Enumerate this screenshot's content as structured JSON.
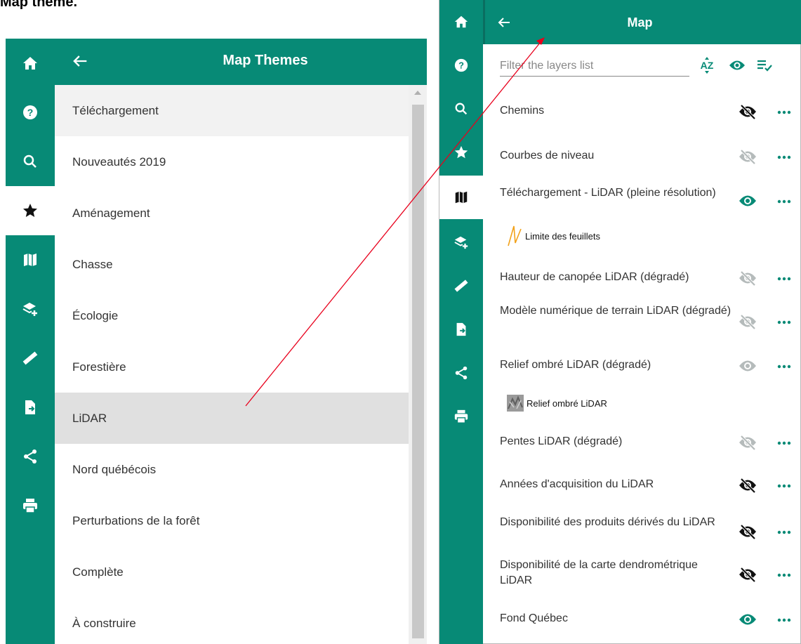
{
  "caption": "Map theme.",
  "colors": {
    "brand": "#078a76",
    "eye_active": "#078a76",
    "eye_inactive": "#9aa0a0",
    "eye_hidden": "#111111",
    "annotation": "#e8001c"
  },
  "left_panel": {
    "header_title": "Map Themes",
    "rail_icons": [
      "home-icon",
      "help-icon",
      "search-icon",
      "star-icon",
      "map-icon",
      "add-layer-icon",
      "ruler-icon",
      "export-icon",
      "share-icon",
      "print-icon"
    ],
    "active_rail": "star-icon",
    "themes": [
      {
        "label": "Téléchargement"
      },
      {
        "label": "Nouveautés 2019"
      },
      {
        "label": "Aménagement"
      },
      {
        "label": "Chasse"
      },
      {
        "label": "Écologie"
      },
      {
        "label": "Forestière"
      },
      {
        "label": "LiDAR"
      },
      {
        "label": "Nord québécois"
      },
      {
        "label": "Perturbations de la forêt"
      },
      {
        "label": "Complète"
      },
      {
        "label": "À construire"
      }
    ],
    "selected_theme": "LiDAR"
  },
  "right_panel": {
    "header_title": "Map",
    "filter_placeholder": "Filter the layers list",
    "toolbar": {
      "sort_label": "AZ",
      "visibility_icon": "eye-icon",
      "select_icon": "checklist-icon"
    },
    "rail_icons": [
      "home-icon",
      "help-icon",
      "search-icon",
      "star-icon",
      "map-icon",
      "add-layer-icon",
      "ruler-icon",
      "export-icon",
      "share-icon",
      "print-icon"
    ],
    "active_rail": "map-icon",
    "layers": [
      {
        "name": "Chemins",
        "visibility": "hidden"
      },
      {
        "name": "Courbes de niveau",
        "visibility": "hidden-inactive"
      },
      {
        "name": "Téléchargement - LiDAR (pleine résolution)",
        "visibility": "visible",
        "legend": "Limite des feuillets"
      },
      {
        "name": "Hauteur de canopée LiDAR (dégradé)",
        "visibility": "hidden-inactive"
      },
      {
        "name": "Modèle numérique de terrain LiDAR (dégradé)",
        "visibility": "hidden-inactive"
      },
      {
        "name": "Relief ombré LiDAR (dégradé)",
        "visibility": "visible-inactive",
        "legend": "Relief ombré LiDAR"
      },
      {
        "name": "Pentes LiDAR (dégradé)",
        "visibility": "hidden-inactive"
      },
      {
        "name": "Années d'acquisition du LiDAR",
        "visibility": "hidden"
      },
      {
        "name": "Disponibilité des produits dérivés du LiDAR",
        "visibility": "hidden"
      },
      {
        "name": "Disponibilité de la carte dendrométrique LiDAR",
        "visibility": "hidden"
      },
      {
        "name": "Fond Québec",
        "visibility": "visible"
      }
    ]
  }
}
